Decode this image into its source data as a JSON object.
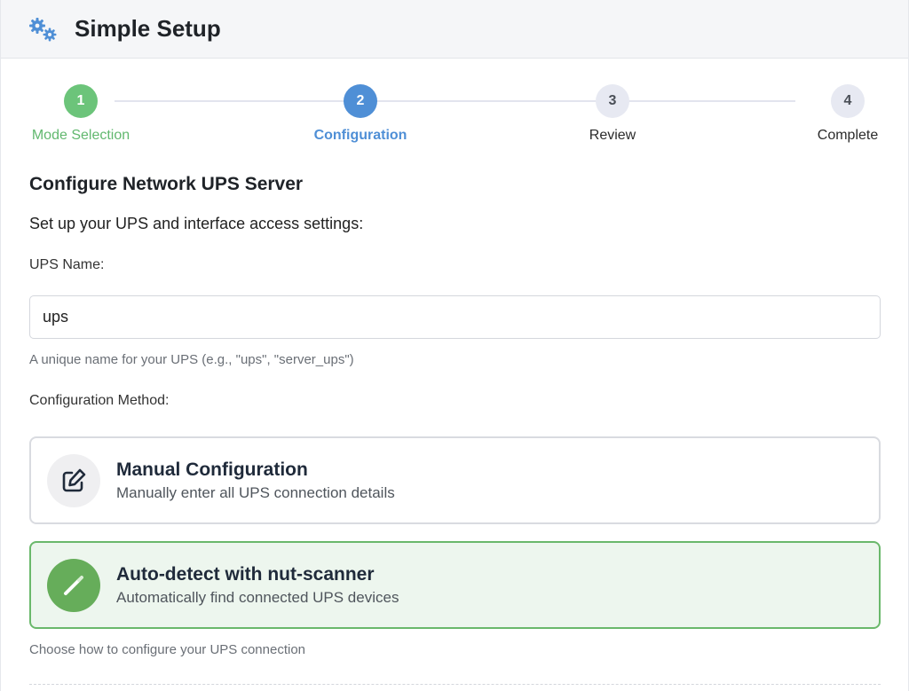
{
  "header": {
    "title": "Simple Setup",
    "icon": "gears-icon"
  },
  "stepper": {
    "steps": [
      {
        "number": "1",
        "label": "Mode Selection",
        "state": "done"
      },
      {
        "number": "2",
        "label": "Configuration",
        "state": "active"
      },
      {
        "number": "3",
        "label": "Review",
        "state": "todo"
      },
      {
        "number": "4",
        "label": "Complete",
        "state": "todo"
      }
    ]
  },
  "form": {
    "title": "Configure Network UPS Server",
    "intro": "Set up your UPS and interface access settings:",
    "ups_name": {
      "label": "UPS Name:",
      "value": "ups",
      "help": "A unique name for your UPS (e.g., \"ups\", \"server_ups\")"
    },
    "method": {
      "label": "Configuration Method:",
      "options": [
        {
          "title": "Manual Configuration",
          "description": "Manually enter all UPS connection details",
          "icon": "edit-icon",
          "selected": false
        },
        {
          "title": "Auto-detect with nut-scanner",
          "description": "Automatically find connected UPS devices",
          "icon": "magic-wand-icon",
          "selected": true
        }
      ],
      "help": "Choose how to configure your UPS connection"
    }
  },
  "colors": {
    "done": "#6cc47a",
    "active": "#4f8fd6",
    "selected_bg": "#edf6ee",
    "selected_border": "#6ab86b"
  }
}
